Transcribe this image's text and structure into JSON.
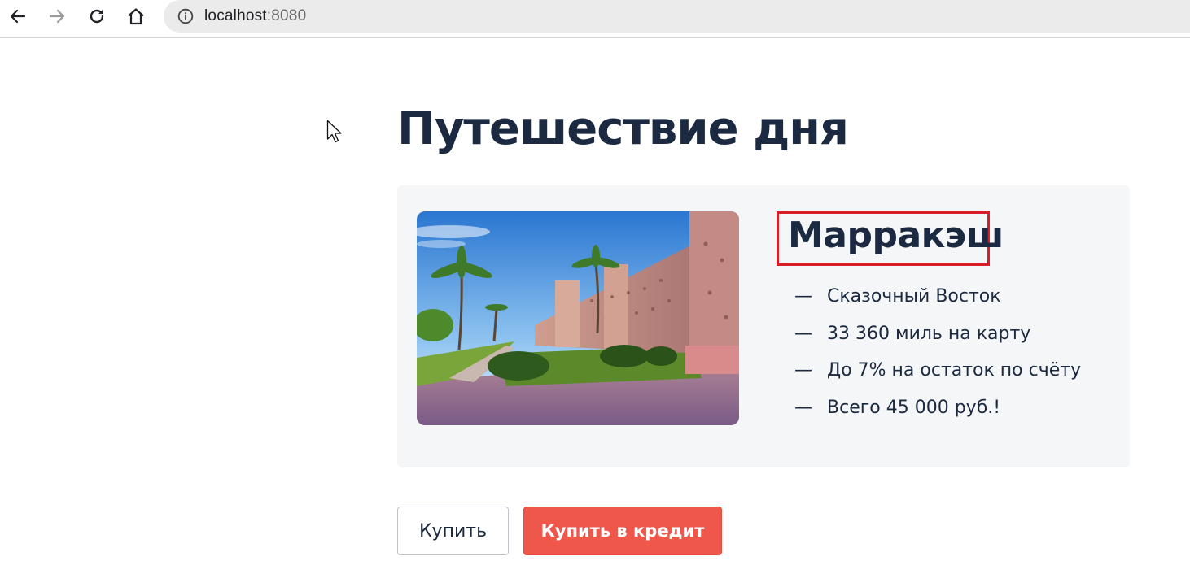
{
  "browser": {
    "url_host": "localhost",
    "url_port": ":8080",
    "icons": [
      "arrow-left-icon",
      "arrow-right-icon",
      "reload-icon",
      "home-icon",
      "info-icon"
    ]
  },
  "page": {
    "title": "Путешествие дня"
  },
  "offer": {
    "city": "Марракэш",
    "dash": "—",
    "features": [
      "Сказочный Восток",
      "33 360 миль на карту",
      "До 7% на остаток по счёту",
      "Всего 45 000 руб.!"
    ]
  },
  "actions": {
    "buy_label": "Купить",
    "credit_label": "Купить в кредит"
  },
  "colors": {
    "heading": "#1b2a41",
    "credit_button": "#f0574b",
    "highlight_frame": "#d5202a"
  }
}
